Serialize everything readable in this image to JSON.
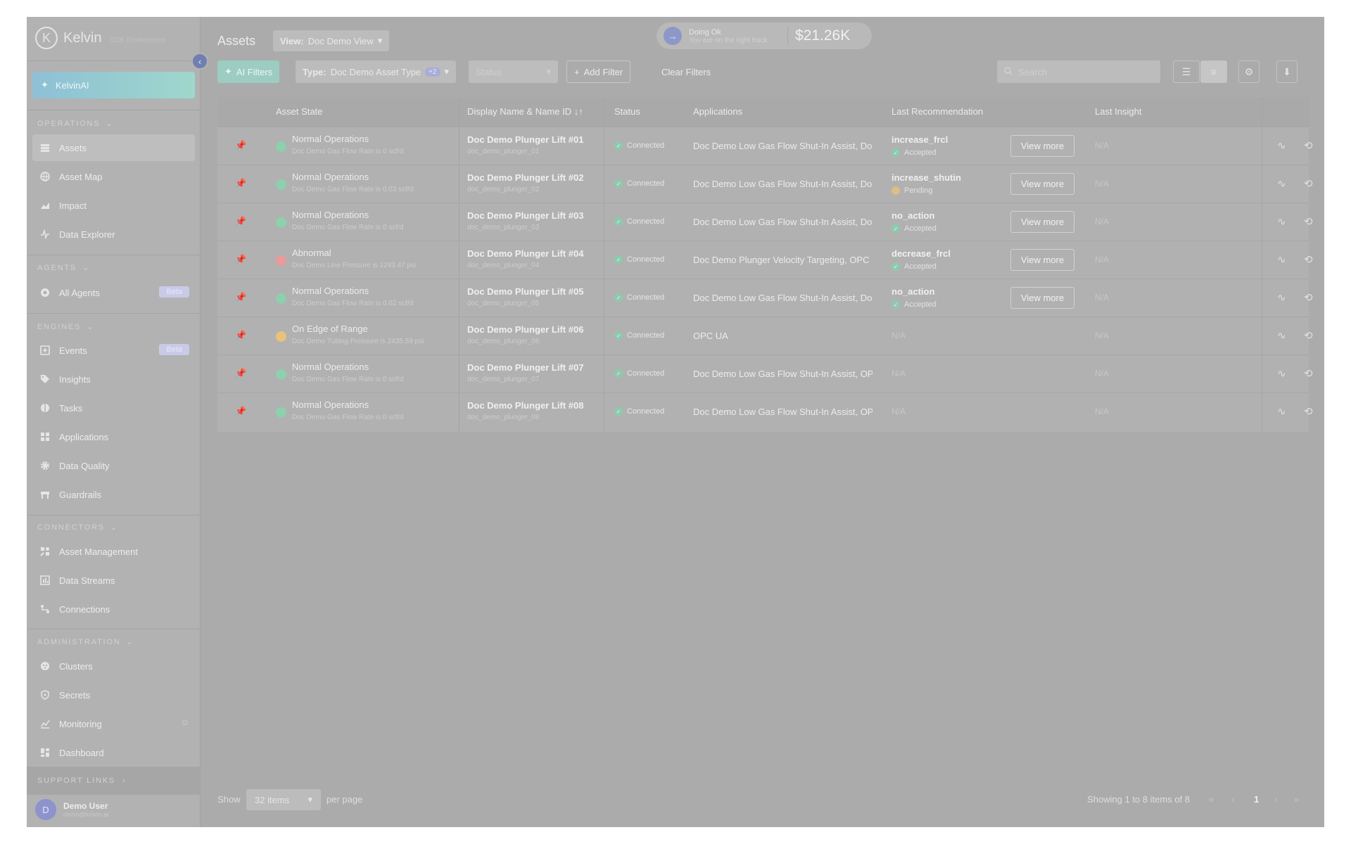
{
  "sidebar": {
    "brand": "Kelvin",
    "brand_sub": "SDK Environment",
    "ai_label": "KelvinAI",
    "sections": [
      {
        "title": "OPERATIONS",
        "items": [
          {
            "label": "Assets"
          },
          {
            "label": "Asset Map"
          },
          {
            "label": "Impact"
          },
          {
            "label": "Data Explorer"
          }
        ]
      },
      {
        "title": "AGENTS",
        "items": [
          {
            "label": "All Agents",
            "badge": "Beta"
          }
        ]
      },
      {
        "title": "ENGINES",
        "items": [
          {
            "label": "Events",
            "badge": "Beta"
          },
          {
            "label": "Insights"
          },
          {
            "label": "Tasks"
          },
          {
            "label": "Applications"
          },
          {
            "label": "Data Quality"
          },
          {
            "label": "Guardrails"
          }
        ]
      },
      {
        "title": "CONNECTORS",
        "items": [
          {
            "label": "Asset Management"
          },
          {
            "label": "Data Streams"
          },
          {
            "label": "Connections"
          }
        ]
      },
      {
        "title": "ADMINISTRATION",
        "items": [
          {
            "label": "Clusters"
          },
          {
            "label": "Secrets"
          },
          {
            "label": "Monitoring"
          },
          {
            "label": "Dashboard"
          }
        ]
      }
    ],
    "support_title": "SUPPORT LINKS",
    "user": {
      "initial": "D",
      "name": "Demo User",
      "email": "demo@kelvin.ai"
    }
  },
  "header": {
    "title": "Assets",
    "view_prefix": "View:",
    "view_value": "Doc Demo View",
    "status_title": "Doing Ok",
    "status_sub": "You are on the right track",
    "status_value": "$21.26K"
  },
  "filters": {
    "ai_label": "AI Filters",
    "type_prefix": "Type:",
    "type_value": "Doc Demo Asset Type",
    "type_extra": "+2",
    "status_placeholder": "Status",
    "add_label": "Add Filter",
    "clear_label": "Clear Filters",
    "search_placeholder": "Search"
  },
  "table": {
    "headers": {
      "state": "Asset State",
      "name": "Display Name & Name ID",
      "status": "Status",
      "applications": "Applications",
      "recommendation": "Last Recommendation",
      "insight": "Last Insight"
    },
    "view_more_label": "View more",
    "rows": [
      {
        "state": "Normal Operations",
        "state_color": "#8dd0ae",
        "detail": "Doc Demo Gas Flow Rate is 0 scf/d",
        "name": "Doc Demo Plunger Lift #01",
        "id": "doc_demo_plunger_01",
        "status": "Connected",
        "apps": "Doc Demo Low Gas Flow Shut-In Assist, Doc Demo Plunger Velocity Targeting",
        "rec": "increase_frcl",
        "rec_status": "Accepted",
        "insight": "N/A"
      },
      {
        "state": "Normal Operations",
        "state_color": "#8dd0ae",
        "detail": "Doc Demo Gas Flow Rate is 0.03 scf/d",
        "name": "Doc Demo Plunger Lift #02",
        "id": "doc_demo_plunger_02",
        "status": "Connected",
        "apps": "Doc Demo Low Gas Flow Shut-In Assist, Doc Demo Plunger Velocity Targeting",
        "rec": "increase_shutin",
        "rec_status": "Pending",
        "insight": "N/A"
      },
      {
        "state": "Normal Operations",
        "state_color": "#8dd0ae",
        "detail": "Doc Demo Gas Flow Rate is 0 scf/d",
        "name": "Doc Demo Plunger Lift #03",
        "id": "doc_demo_plunger_03",
        "status": "Connected",
        "apps": "Doc Demo Low Gas Flow Shut-In Assist, Doc Demo Plunger Velocity Targeting",
        "rec": "no_action",
        "rec_status": "Accepted",
        "insight": "N/A"
      },
      {
        "state": "Abnormal",
        "state_color": "#e99a9a",
        "detail": "Doc Demo Line Pressure is 1293.47 psi",
        "name": "Doc Demo Plunger Lift #04",
        "id": "doc_demo_plunger_04",
        "status": "Connected",
        "apps": "Doc Demo Plunger Velocity Targeting, OPC UA",
        "rec": "decrease_frcl",
        "rec_status": "Accepted",
        "insight": "N/A"
      },
      {
        "state": "Normal Operations",
        "state_color": "#8dd0ae",
        "detail": "Doc Demo Gas Flow Rate is 0.02 scf/d",
        "name": "Doc Demo Plunger Lift #05",
        "id": "doc_demo_plunger_05",
        "status": "Connected",
        "apps": "Doc Demo Low Gas Flow Shut-In Assist, Doc Demo Plunger Velocity Targeting",
        "rec": "no_action",
        "rec_status": "Accepted",
        "insight": "N/A"
      },
      {
        "state": "On Edge of Range",
        "state_color": "#e9c27a",
        "detail": "Doc Demo Tubing Pressure is 2435.59 psi",
        "name": "Doc Demo Plunger Lift #06",
        "id": "doc_demo_plunger_06",
        "status": "Connected",
        "apps": "OPC UA",
        "rec": "N/A",
        "rec_status": "",
        "insight": "N/A"
      },
      {
        "state": "Normal Operations",
        "state_color": "#8dd0ae",
        "detail": "Doc Demo Gas Flow Rate is 0 scf/d",
        "name": "Doc Demo Plunger Lift #07",
        "id": "doc_demo_plunger_07",
        "status": "Connected",
        "apps": "Doc Demo Low Gas Flow Shut-In Assist, OPC UA",
        "rec": "N/A",
        "rec_status": "",
        "insight": "N/A"
      },
      {
        "state": "Normal Operations",
        "state_color": "#8dd0ae",
        "detail": "Doc Demo Gas Flow Rate is 0 scf/d",
        "name": "Doc Demo Plunger Lift #08",
        "id": "doc_demo_plunger_08",
        "status": "Connected",
        "apps": "Doc Demo Low Gas Flow Shut-In Assist, OPC UA",
        "rec": "N/A",
        "rec_status": "",
        "insight": "N/A"
      }
    ]
  },
  "pagination": {
    "show_label": "Show",
    "per_page_value": "32 items",
    "per_page_label": "per page",
    "summary": "Showing 1 to 8 items of 8",
    "current_page": "1"
  }
}
